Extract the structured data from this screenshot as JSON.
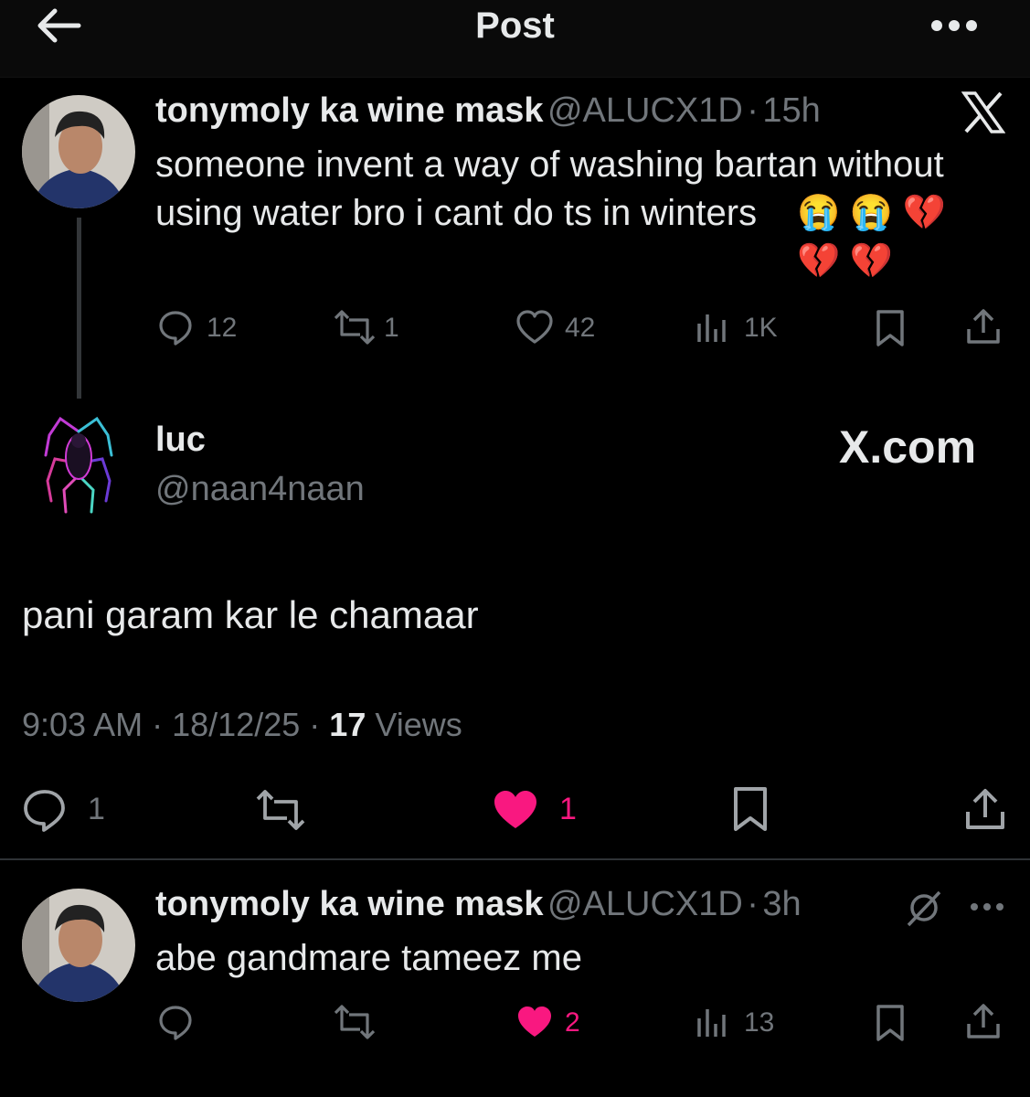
{
  "header": {
    "title": "Post"
  },
  "quoted": {
    "name": "tonymoly ka wine mask",
    "handle": "@ALUCX1D",
    "sep": "·",
    "time": "15h",
    "text": "someone invent a way of washing bartan without using water bro i cant do ts in winters",
    "emoji": "😭 😭 💔\n💔 💔",
    "counts": {
      "reply": "12",
      "retweet": "1",
      "like": "42",
      "views": "1K"
    }
  },
  "main": {
    "name": "luc",
    "handle": "@naan4naan",
    "watermark": "X.com",
    "text": "pani garam kar le chamaar",
    "meta": {
      "time": "9:03 AM",
      "sep1": "·",
      "date": "18/12/25",
      "sep2": "·",
      "views_count": "17",
      "views_label": "Views"
    },
    "counts": {
      "reply": "1",
      "like": "1"
    }
  },
  "reply": {
    "name": "tonymoly ka wine mask",
    "handle": "@ALUCX1D",
    "sep": "·",
    "time": "3h",
    "text": "abe gandmare tameez me",
    "counts": {
      "like": "2",
      "views": "13"
    }
  },
  "colors": {
    "like_active": "#f91880",
    "muted": "#71767b",
    "text": "#e7e9ea"
  }
}
